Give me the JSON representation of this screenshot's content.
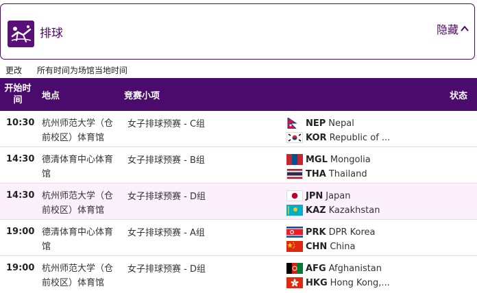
{
  "header": {
    "title": "排球",
    "collapse_label": "隐藏"
  },
  "subbar": {
    "change": "更改",
    "note": "所有时间为场馆当地时间"
  },
  "table": {
    "headers": {
      "time": "开始时间",
      "venue": "地点",
      "event": "竞赛小项",
      "status": "状态"
    },
    "rows": [
      {
        "time": "10:30",
        "venue": "杭州师范大学（仓前校区）体育馆",
        "event": "女子排球预赛 - C组",
        "teams": [
          {
            "code": "NEP",
            "name": "Nepal"
          },
          {
            "code": "KOR",
            "name": "Republic of ..."
          }
        ]
      },
      {
        "time": "14:30",
        "venue": "德清体育中心体育馆",
        "event": "女子排球预赛 - B组",
        "teams": [
          {
            "code": "MGL",
            "name": "Mongolia"
          },
          {
            "code": "THA",
            "name": "Thailand"
          }
        ]
      },
      {
        "time": "14:30",
        "venue": "杭州师范大学（仓前校区）体育馆",
        "event": "女子排球预赛 - D组",
        "teams": [
          {
            "code": "JPN",
            "name": "Japan"
          },
          {
            "code": "KAZ",
            "name": "Kazakhstan"
          }
        ]
      },
      {
        "time": "19:00",
        "venue": "德清体育中心体育馆",
        "event": "女子排球预赛 - A组",
        "teams": [
          {
            "code": "PRK",
            "name": "DPR Korea"
          },
          {
            "code": "CHN",
            "name": "China"
          }
        ]
      },
      {
        "time": "19:00",
        "venue": "杭州师范大学（仓前校区）体育馆",
        "event": "女子排球预赛 - D组",
        "teams": [
          {
            "code": "AFG",
            "name": "Afghanistan"
          },
          {
            "code": "HKG",
            "name": "Hong Kong,..."
          }
        ]
      }
    ]
  },
  "colors": {
    "brand": "#4b0b6d",
    "row_highlight": "#fbf0fc"
  }
}
